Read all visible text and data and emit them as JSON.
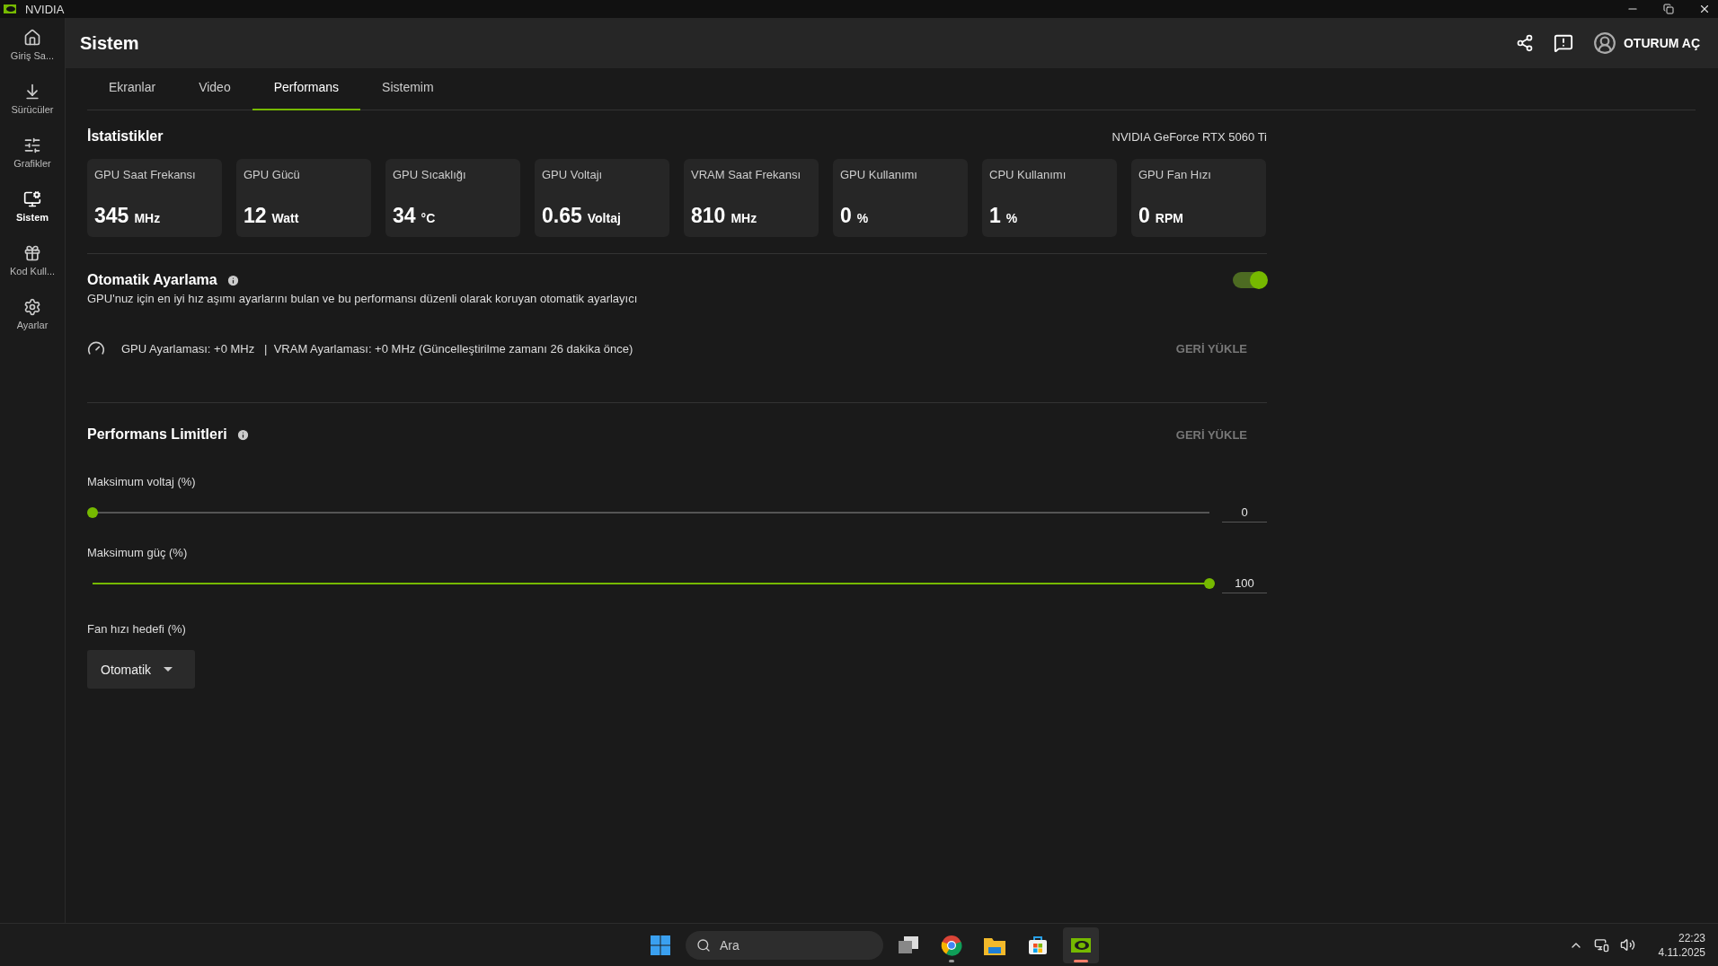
{
  "title_bar": {
    "app_name": "NVIDIA"
  },
  "sidebar": {
    "items": [
      {
        "label": "Giriş Sa...",
        "selected": false
      },
      {
        "label": "Sürücüler",
        "selected": false
      },
      {
        "label": "Grafikler",
        "selected": false
      },
      {
        "label": "Sistem",
        "selected": true
      },
      {
        "label": "Kod Kull...",
        "selected": false
      },
      {
        "label": "Ayarlar",
        "selected": false
      }
    ]
  },
  "header": {
    "title": "Sistem",
    "sign_in": "OTURUM AÇ"
  },
  "tabs": [
    {
      "label": "Ekranlar",
      "selected": false
    },
    {
      "label": "Video",
      "selected": false
    },
    {
      "label": "Performans",
      "selected": true
    },
    {
      "label": "Sistemim",
      "selected": false
    }
  ],
  "statistics": {
    "title": "İstatistikler",
    "gpu_name": "NVIDIA GeForce RTX 5060 Ti",
    "cards": [
      {
        "label": "GPU Saat Frekansı",
        "value": "345",
        "unit": "MHz"
      },
      {
        "label": "GPU Gücü",
        "value": "12",
        "unit": "Watt"
      },
      {
        "label": "GPU Sıcaklığı",
        "value": "34",
        "unit": "°C"
      },
      {
        "label": "GPU Voltajı",
        "value": "0.65",
        "unit": "Voltaj"
      },
      {
        "label": "VRAM Saat Frekansı",
        "value": "810",
        "unit": "MHz"
      },
      {
        "label": "GPU Kullanımı",
        "value": "0",
        "unit": "%"
      },
      {
        "label": "CPU Kullanımı",
        "value": "1",
        "unit": "%"
      },
      {
        "label": "GPU Fan Hızı",
        "value": "0",
        "unit": "RPM"
      }
    ]
  },
  "auto_tuning": {
    "title": "Otomatik Ayarlama",
    "description": "GPU'nuz için en iyi hız aşımı ayarlarını bulan ve bu performansı düzenli olarak koruyan otomatik ayarlayıcı",
    "on": true,
    "status": "GPU Ayarlaması: +0 MHz   |  VRAM Ayarlaması: +0 MHz (Güncelleştirilme zamanı 26 dakika önce)",
    "restore": "GERİ YÜKLE"
  },
  "limits": {
    "title": "Performans Limitleri",
    "restore": "GERİ YÜKLE",
    "sliders": [
      {
        "label": "Maksimum voltaj (%)",
        "level": 0,
        "reading": "0"
      },
      {
        "label": "Maksimum güç (%)",
        "level": 1,
        "reading": "100"
      }
    ],
    "fan": {
      "label": "Fan hızı hedefi (%)",
      "value": "Otomatik"
    }
  },
  "taskbar": {
    "search_placeholder": "Ara",
    "apps": [
      {
        "kind": "taskview",
        "running": false,
        "selected": false
      },
      {
        "kind": "browser",
        "running": true,
        "selected": false
      },
      {
        "kind": "folder",
        "running": false,
        "selected": false
      },
      {
        "kind": "store",
        "running": false,
        "selected": false
      },
      {
        "kind": "nvidia",
        "running": true,
        "selected": true
      }
    ],
    "time": "22:23",
    "date": "4.11.2025"
  }
}
